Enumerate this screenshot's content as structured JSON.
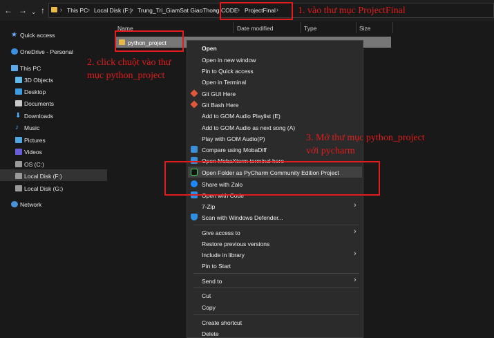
{
  "breadcrumb": [
    "This PC",
    "Local Disk (F:)",
    "Trung_Tri_GiamSat GiaoThong",
    "CODE",
    "ProjectFinal"
  ],
  "sidebar": {
    "items": [
      "Quick access",
      "OneDrive - Personal",
      "This PC",
      "3D Objects",
      "Desktop",
      "Documents",
      "Downloads",
      "Music",
      "Pictures",
      "Videos",
      "OS (C:)",
      "Local Disk (F:)",
      "Local Disk (G:)",
      "Network"
    ]
  },
  "columns": [
    "Name",
    "Date modified",
    "Type",
    "Size"
  ],
  "folder": {
    "name": "python_project"
  },
  "menu": {
    "items": [
      "Open",
      "Open in new window",
      "Pin to Quick access",
      "Open in Terminal",
      "Git GUI Here",
      "Git Bash Here",
      "Add to GOM Audio Playlist (E)",
      "Add to GOM Audio as next song (A)",
      "Play with GOM Audio(P)",
      "Compare using MobaDiff",
      "Open MobaXterm terminal here",
      "Open Folder as PyCharm Community Edition Project",
      "Share with Zalo",
      "Open with Code",
      "7-Zip",
      "Scan with Windows Defender...",
      "Give access to",
      "Restore previous versions",
      "Include in library",
      "Pin to Start",
      "Send to",
      "Cut",
      "Copy",
      "Create shortcut",
      "Delete"
    ]
  },
  "annotations": {
    "step1": "1. vào thư mục ProjectFinal",
    "step2_line1": "2. click chuột vào thư",
    "step2_line2": "mục python_project",
    "step3_line1": "3. Mở thư mục python_project",
    "step3_line2": "với pycharm"
  },
  "colors": {
    "annotation": "#e21c1c",
    "menu_bg": "#2b2b2b",
    "highlight": "#414141"
  }
}
